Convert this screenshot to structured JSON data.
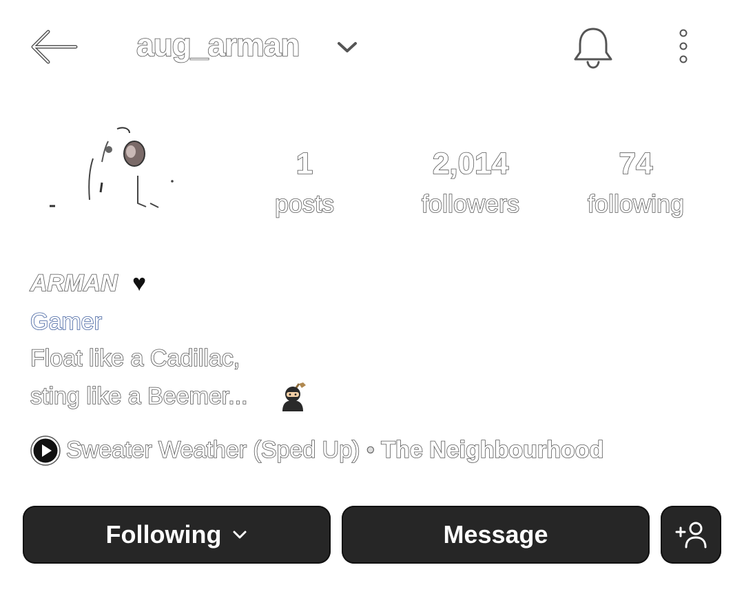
{
  "header": {
    "username": "aug_arman",
    "icons": {
      "back": "back-arrow-icon",
      "username_dropdown": "chevron-down-icon",
      "notifications": "bell-icon",
      "more": "more-vertical-icon"
    }
  },
  "profile": {
    "stats": {
      "posts": {
        "count": "1",
        "label": "posts"
      },
      "followers": {
        "count": "2,014",
        "label": "followers"
      },
      "following": {
        "count": "74",
        "label": "following"
      }
    },
    "bio": {
      "display_name": "ARMAN",
      "heart": "♥",
      "category": "Gamer",
      "line1": "Float like a Cadillac,",
      "line2": "sting like a Beemer...",
      "emoji_icon": "ninja-emoji-icon"
    },
    "music": {
      "song": "Sweater Weather (Sped Up)",
      "separator": "•",
      "artist": "The Neighbourhood",
      "icon": "play-circle-icon"
    }
  },
  "actions": {
    "following_label": "Following",
    "message_label": "Message",
    "add_user_icon": "add-user-icon"
  },
  "colors": {
    "button_bg": "#262626",
    "button_text": "#ffffff",
    "category_link": "#3b5b9c",
    "background": "#ffffff"
  }
}
